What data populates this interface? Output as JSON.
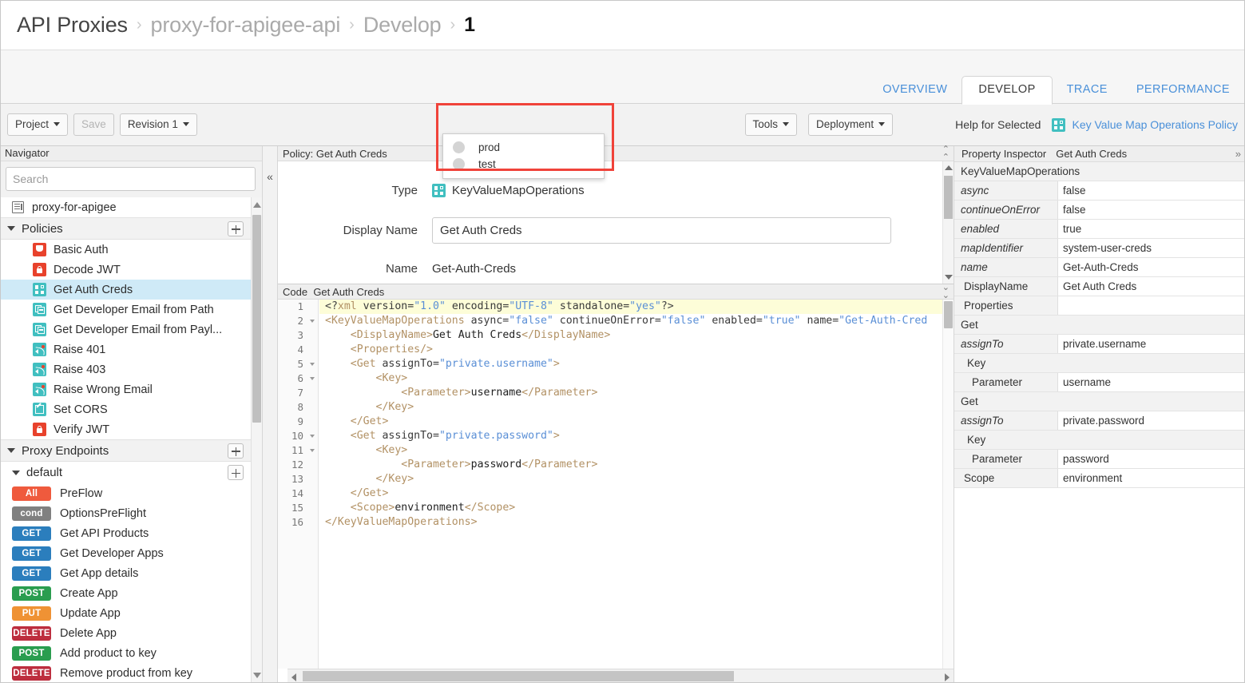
{
  "breadcrumb": {
    "items": [
      {
        "label": "API Proxies",
        "style": "dark"
      },
      {
        "label": "proxy-for-apigee-api",
        "style": "muted"
      },
      {
        "label": "Develop",
        "style": "muted"
      },
      {
        "label": "1",
        "style": "current"
      }
    ],
    "separator": "›"
  },
  "tabs": [
    {
      "label": "OVERVIEW",
      "active": false
    },
    {
      "label": "DEVELOP",
      "active": true
    },
    {
      "label": "TRACE",
      "active": false
    },
    {
      "label": "PERFORMANCE",
      "active": false
    }
  ],
  "toolbar": {
    "project_label": "Project",
    "save_label": "Save",
    "revision_label": "Revision 1",
    "tools_label": "Tools",
    "deployment_label": "Deployment",
    "deployment_menu": [
      {
        "label": "prod"
      },
      {
        "label": "test"
      }
    ],
    "help_label": "Help for Selected",
    "help_link": "Key Value Map Operations Policy"
  },
  "navigator": {
    "title": "Navigator",
    "search_placeholder": "Search",
    "collapse_icon": "«",
    "root": {
      "label": "proxy-for-apigee",
      "icon": "document-icon"
    },
    "policies_group": {
      "label": "Policies",
      "add_label": "+"
    },
    "policies": [
      {
        "label": "Basic Auth",
        "icon": "shield-icon",
        "color": "red",
        "selected": false
      },
      {
        "label": "Decode JWT",
        "icon": "lock-icon",
        "color": "red",
        "selected": false
      },
      {
        "label": "Get Auth Creds",
        "icon": "key-value-map-icon",
        "color": "teal",
        "selected": true
      },
      {
        "label": "Get Developer Email from Path",
        "icon": "extract-variables-icon",
        "color": "teal",
        "selected": false
      },
      {
        "label": "Get Developer Email from Payl...",
        "icon": "extract-variables-icon",
        "color": "teal",
        "selected": false
      },
      {
        "label": "Raise 401",
        "icon": "raise-fault-icon",
        "color": "teal",
        "selected": false
      },
      {
        "label": "Raise 403",
        "icon": "raise-fault-icon",
        "color": "teal",
        "selected": false
      },
      {
        "label": "Raise Wrong Email",
        "icon": "raise-fault-icon",
        "color": "teal",
        "selected": false
      },
      {
        "label": "Set CORS",
        "icon": "assign-message-icon",
        "color": "teal",
        "selected": false
      },
      {
        "label": "Verify JWT",
        "icon": "lock-icon",
        "color": "red",
        "selected": false
      }
    ],
    "endpoints_group": {
      "label": "Proxy Endpoints",
      "add_label": "+"
    },
    "default_endpoint": {
      "label": "default",
      "add_label": "+"
    },
    "flows": [
      {
        "verb": "All",
        "verb_class": "all",
        "label": "PreFlow"
      },
      {
        "verb": "cond",
        "verb_class": "cond",
        "label": "OptionsPreFlight"
      },
      {
        "verb": "GET",
        "verb_class": "get",
        "label": "Get API Products"
      },
      {
        "verb": "GET",
        "verb_class": "get",
        "label": "Get Developer Apps"
      },
      {
        "verb": "GET",
        "verb_class": "get",
        "label": "Get App details"
      },
      {
        "verb": "POST",
        "verb_class": "post",
        "label": "Create App"
      },
      {
        "verb": "PUT",
        "verb_class": "put",
        "label": "Update App"
      },
      {
        "verb": "DELETE",
        "verb_class": "delete",
        "label": "Delete App"
      },
      {
        "verb": "POST",
        "verb_class": "post",
        "label": "Add product to key"
      },
      {
        "verb": "DELETE",
        "verb_class": "delete",
        "label": "Remove product from key"
      }
    ]
  },
  "policy_panel": {
    "header": "Policy: Get Auth Creds",
    "type_label": "Type",
    "type_value": "KeyValueMapOperations",
    "display_name_label": "Display Name",
    "display_name_value": "Get Auth Creds",
    "name_label": "Name",
    "name_value": "Get-Auth-Creds"
  },
  "code_panel": {
    "header_label": "Code",
    "header_name": "Get Auth Creds",
    "lines": [
      {
        "n": 1,
        "fold": false,
        "highlight": true,
        "tokens": [
          {
            "t": "<?",
            "c": "tk-pi"
          },
          {
            "t": "xml",
            "c": "tk-tag"
          },
          {
            "t": " version=",
            "c": "tk-attr"
          },
          {
            "t": "\"1.0\"",
            "c": "tk-str"
          },
          {
            "t": " encoding=",
            "c": "tk-attr"
          },
          {
            "t": "\"UTF-8\"",
            "c": "tk-str"
          },
          {
            "t": " standalone=",
            "c": "tk-attr"
          },
          {
            "t": "\"yes\"",
            "c": "tk-str"
          },
          {
            "t": "?>",
            "c": "tk-pi"
          }
        ]
      },
      {
        "n": 2,
        "fold": true,
        "highlight": false,
        "tokens": [
          {
            "t": "<KeyValueMapOperations",
            "c": "tk-tag"
          },
          {
            "t": " async=",
            "c": "tk-attr"
          },
          {
            "t": "\"false\"",
            "c": "tk-str"
          },
          {
            "t": " continueOnError=",
            "c": "tk-attr"
          },
          {
            "t": "\"false\"",
            "c": "tk-str"
          },
          {
            "t": " enabled=",
            "c": "tk-attr"
          },
          {
            "t": "\"true\"",
            "c": "tk-str"
          },
          {
            "t": " name=",
            "c": "tk-attr"
          },
          {
            "t": "\"Get-Auth-Cred",
            "c": "tk-str"
          }
        ]
      },
      {
        "n": 3,
        "fold": false,
        "highlight": false,
        "tokens": [
          {
            "t": "    <DisplayName>",
            "c": "tk-tag"
          },
          {
            "t": "Get Auth Creds",
            "c": "tk-txt"
          },
          {
            "t": "</DisplayName>",
            "c": "tk-tag"
          }
        ]
      },
      {
        "n": 4,
        "fold": false,
        "highlight": false,
        "tokens": [
          {
            "t": "    <Properties/>",
            "c": "tk-tag"
          }
        ]
      },
      {
        "n": 5,
        "fold": true,
        "highlight": false,
        "tokens": [
          {
            "t": "    <Get",
            "c": "tk-tag"
          },
          {
            "t": " assignTo=",
            "c": "tk-attr"
          },
          {
            "t": "\"private.username\"",
            "c": "tk-str"
          },
          {
            "t": ">",
            "c": "tk-tag"
          }
        ]
      },
      {
        "n": 6,
        "fold": true,
        "highlight": false,
        "tokens": [
          {
            "t": "        <Key>",
            "c": "tk-tag"
          }
        ]
      },
      {
        "n": 7,
        "fold": false,
        "highlight": false,
        "tokens": [
          {
            "t": "            <Parameter>",
            "c": "tk-tag"
          },
          {
            "t": "username",
            "c": "tk-txt"
          },
          {
            "t": "</Parameter>",
            "c": "tk-tag"
          }
        ]
      },
      {
        "n": 8,
        "fold": false,
        "highlight": false,
        "tokens": [
          {
            "t": "        </Key>",
            "c": "tk-tag"
          }
        ]
      },
      {
        "n": 9,
        "fold": false,
        "highlight": false,
        "tokens": [
          {
            "t": "    </Get>",
            "c": "tk-tag"
          }
        ]
      },
      {
        "n": 10,
        "fold": true,
        "highlight": false,
        "tokens": [
          {
            "t": "    <Get",
            "c": "tk-tag"
          },
          {
            "t": " assignTo=",
            "c": "tk-attr"
          },
          {
            "t": "\"private.password\"",
            "c": "tk-str"
          },
          {
            "t": ">",
            "c": "tk-tag"
          }
        ]
      },
      {
        "n": 11,
        "fold": true,
        "highlight": false,
        "tokens": [
          {
            "t": "        <Key>",
            "c": "tk-tag"
          }
        ]
      },
      {
        "n": 12,
        "fold": false,
        "highlight": false,
        "tokens": [
          {
            "t": "            <Parameter>",
            "c": "tk-tag"
          },
          {
            "t": "password",
            "c": "tk-txt"
          },
          {
            "t": "</Parameter>",
            "c": "tk-tag"
          }
        ]
      },
      {
        "n": 13,
        "fold": false,
        "highlight": false,
        "tokens": [
          {
            "t": "        </Key>",
            "c": "tk-tag"
          }
        ]
      },
      {
        "n": 14,
        "fold": false,
        "highlight": false,
        "tokens": [
          {
            "t": "    </Get>",
            "c": "tk-tag"
          }
        ]
      },
      {
        "n": 15,
        "fold": false,
        "highlight": false,
        "tokens": [
          {
            "t": "    <Scope>",
            "c": "tk-tag"
          },
          {
            "t": "environment",
            "c": "tk-txt"
          },
          {
            "t": "</Scope>",
            "c": "tk-tag"
          }
        ]
      },
      {
        "n": 16,
        "fold": false,
        "highlight": false,
        "tokens": [
          {
            "t": "</KeyValueMapOperations>",
            "c": "tk-tag"
          }
        ]
      }
    ]
  },
  "inspector": {
    "title": "Property Inspector",
    "subject": "Get Auth Creds",
    "expand_icon": "»",
    "rows": [
      {
        "kind": "section",
        "name": "KeyValueMapOperations",
        "value": ""
      },
      {
        "kind": "attr",
        "name": "async",
        "value": "false"
      },
      {
        "kind": "attr",
        "name": "continueOnError",
        "value": "false"
      },
      {
        "kind": "attr",
        "name": "enabled",
        "value": "true"
      },
      {
        "kind": "attr",
        "name": "mapIdentifier",
        "value": "system-user-creds"
      },
      {
        "kind": "attr",
        "name": "name",
        "value": "Get-Auth-Creds"
      },
      {
        "kind": "elem",
        "name": "DisplayName",
        "value": "Get Auth Creds"
      },
      {
        "kind": "elem",
        "name": "Properties",
        "value": ""
      },
      {
        "kind": "section",
        "name": "Get",
        "value": ""
      },
      {
        "kind": "attr",
        "name": "assignTo",
        "value": "private.username"
      },
      {
        "kind": "section2",
        "name": "Key",
        "value": ""
      },
      {
        "kind": "elem2",
        "name": "Parameter",
        "value": "username"
      },
      {
        "kind": "section",
        "name": "Get",
        "value": ""
      },
      {
        "kind": "attr",
        "name": "assignTo",
        "value": "private.password"
      },
      {
        "kind": "section2",
        "name": "Key",
        "value": ""
      },
      {
        "kind": "elem2",
        "name": "Parameter",
        "value": "password"
      },
      {
        "kind": "elem",
        "name": "Scope",
        "value": "environment"
      }
    ]
  },
  "colors": {
    "accent_teal": "#41bfc0",
    "accent_red": "#e8422c",
    "link_blue": "#4a90d9",
    "highlight_box": "#f0433a",
    "selection_blue": "#cfeaf7"
  }
}
